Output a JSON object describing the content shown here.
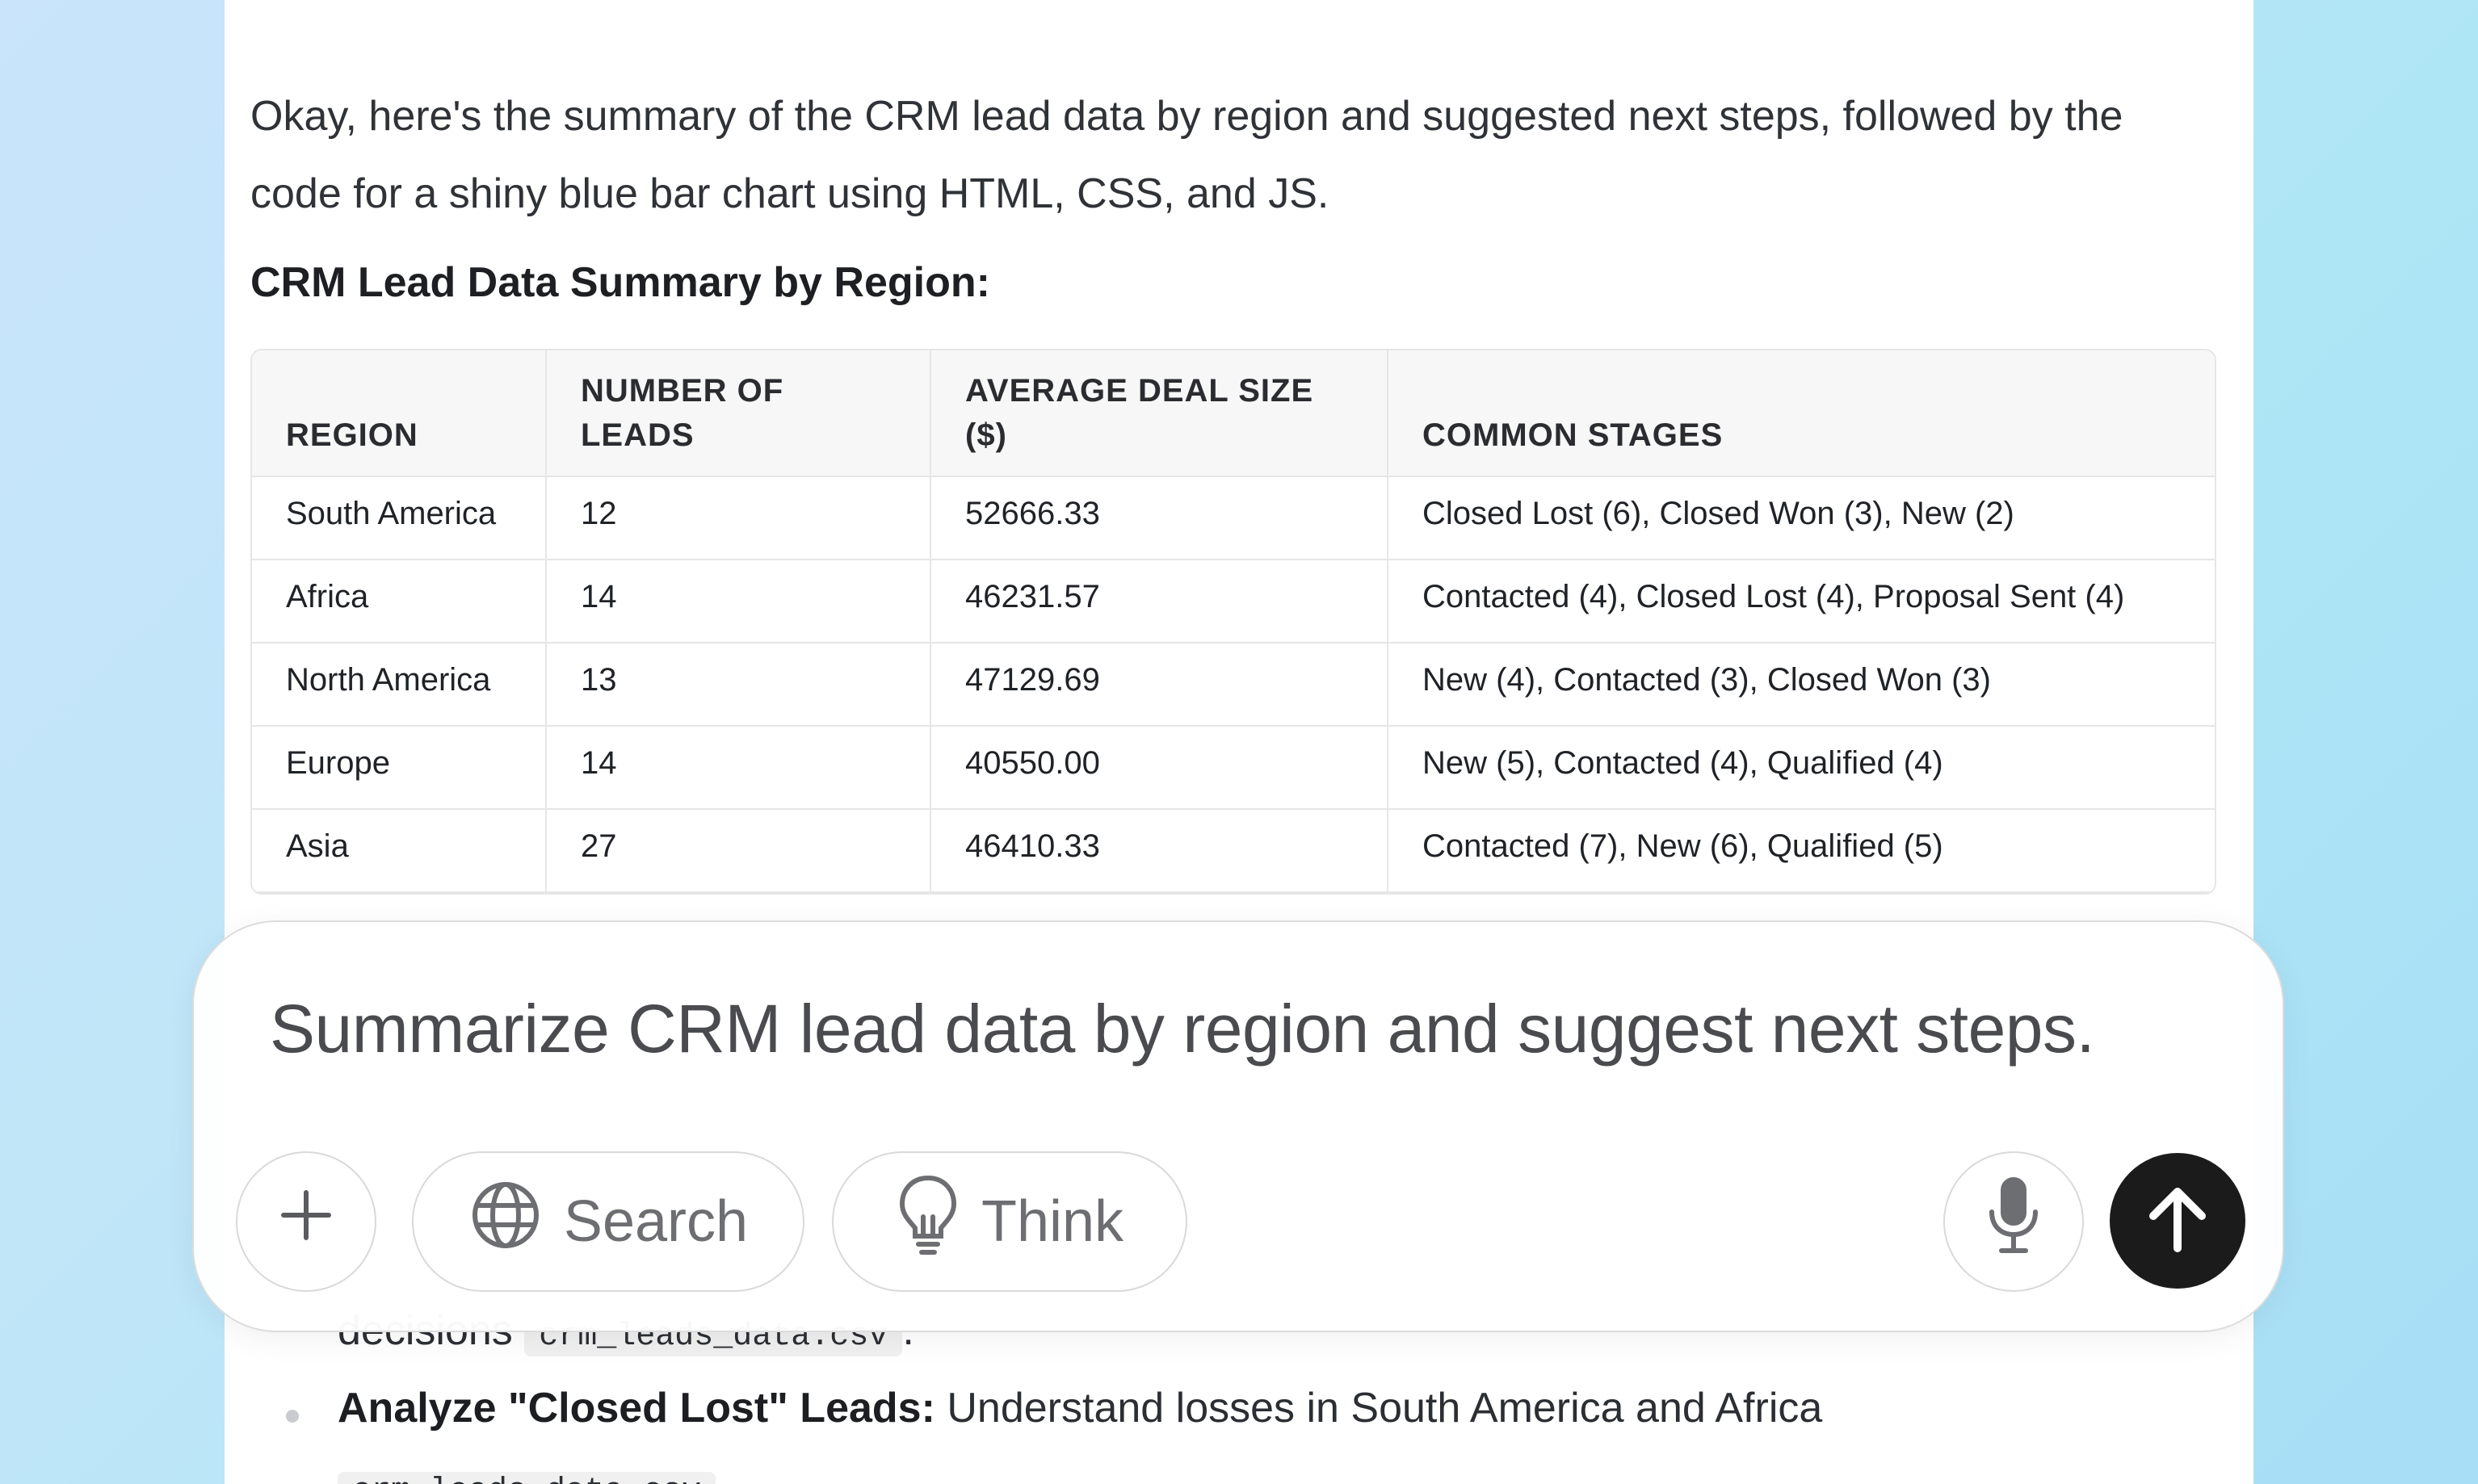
{
  "response": {
    "intro": "Okay, here's the summary of the CRM lead data by region and suggested next steps, followed by the code for a shiny blue bar chart using HTML, CSS, and JS.",
    "heading": "CRM Lead Data Summary by Region:",
    "table": {
      "headers": [
        "REGION",
        "NUMBER OF LEADS",
        "AVERAGE DEAL SIZE ($)",
        "COMMON STAGES"
      ],
      "rows": [
        [
          "South America",
          "12",
          "52666.33",
          "Closed Lost (6), Closed Won (3), New (2)"
        ],
        [
          "Africa",
          "14",
          "46231.57",
          "Contacted (4), Closed Lost (4), Proposal Sent (4)"
        ],
        [
          "North America",
          "13",
          "47129.69",
          "New (4), Contacted (3), Closed Won (3)"
        ],
        [
          "Europe",
          "14",
          "40550.00",
          "New (5), Contacted (4), Qualified (4)"
        ],
        [
          "Asia",
          "27",
          "46410.33",
          "Contacted (7), New (6), Qualified (5)"
        ]
      ]
    },
    "bullets": [
      {
        "bold": "",
        "text": "decisions",
        "code": "crm_leads_data.csv",
        "suffix": "."
      },
      {
        "bold": "Analyze \"Closed Lost\" Leads:",
        "text": " Understand losses in South America and Africa",
        "code": "",
        "suffix": ""
      },
      {
        "bold": "",
        "text": "",
        "code": "crm_leads_data.csv",
        "suffix": ""
      }
    ]
  },
  "composer": {
    "prompt": "Summarize CRM lead data by region and suggest next steps.",
    "search_label": "Search",
    "think_label": "Think"
  },
  "icons": [
    "plus-icon",
    "globe-icon",
    "lightbulb-icon",
    "microphone-icon",
    "arrow-up-icon"
  ],
  "colors": {
    "send_button": "#1b1b1b",
    "page_gradient_start": "#c9e4fb",
    "page_gradient_end": "#a8def6"
  }
}
